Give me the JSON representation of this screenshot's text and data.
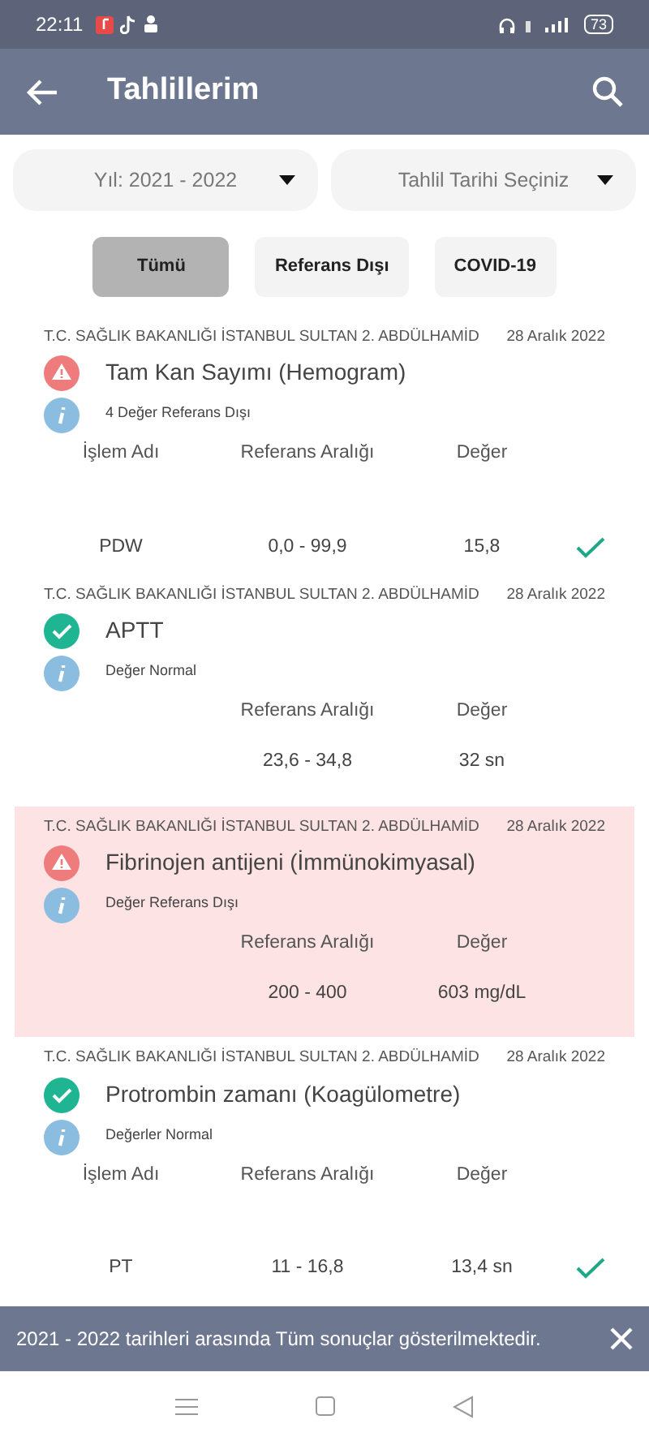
{
  "status_bar": {
    "time": "22:11",
    "battery": "73"
  },
  "app_bar": {
    "title": "Tahlillerim"
  },
  "filters": [
    {
      "label": "Yıl: 2021 - 2022"
    },
    {
      "label": "Tahlil Tarihi Seçiniz"
    }
  ],
  "chips": [
    {
      "label": "Tümü",
      "selected": true
    },
    {
      "label": "Referans Dışı",
      "selected": false
    },
    {
      "label": "COVID-19",
      "selected": false
    }
  ],
  "results": [
    {
      "hospital": "T.C. SAĞLIK BAKANLIĞI İSTANBUL SULTAN 2. ABDÜLHAMİD",
      "date": "28 Aralık 2022",
      "title": "Tam Kan Sayımı (Hemogram)",
      "kind": "alert",
      "highlighted": false,
      "summary": "4 Değer Referans Dışı",
      "columns": [
        "İşlem Adı",
        "Referans Aralığı",
        "Değer"
      ],
      "rows": [
        {
          "name": "PDW",
          "range": "0,0 - 99,9",
          "value": "15,8",
          "checked": true
        }
      ]
    },
    {
      "hospital": "T.C. SAĞLIK BAKANLIĞI İSTANBUL SULTAN 2. ABDÜLHAMİD",
      "date": "28 Aralık 2022",
      "title": "APTT",
      "kind": "ok",
      "highlighted": false,
      "summary": "Değer Normal",
      "columns": [
        "Referans Aralığı",
        "Değer"
      ],
      "rows": [
        {
          "range": "23,6 - 34,8",
          "value": "32 sn",
          "checked": false
        }
      ]
    },
    {
      "hospital": "T.C. SAĞLIK BAKANLIĞI İSTANBUL SULTAN 2. ABDÜLHAMİD",
      "date": "28 Aralık 2022",
      "title": "Fibrinojen antijeni (İmmünokimyasal)",
      "kind": "alert",
      "highlighted": true,
      "summary": "Değer Referans Dışı",
      "columns": [
        "Referans Aralığı",
        "Değer"
      ],
      "rows": [
        {
          "range": "200 - 400",
          "value": "603 mg/dL",
          "checked": false
        }
      ]
    },
    {
      "hospital": "T.C. SAĞLIK BAKANLIĞI İSTANBUL SULTAN 2. ABDÜLHAMİD",
      "date": "28 Aralık 2022",
      "title": "Protrombin zamanı (Koagülometre)",
      "kind": "ok",
      "highlighted": false,
      "summary": "Değerler Normal",
      "columns": [
        "İşlem Adı",
        "Referans Aralığı",
        "Değer"
      ],
      "rows": [
        {
          "name": "PT",
          "range": "11 - 16,8",
          "value": "13,4 sn",
          "checked": true
        }
      ]
    }
  ],
  "snackbar": {
    "message": "2021 - 2022 tarihleri arasında Tüm sonuçlar gösterilmektedir."
  }
}
